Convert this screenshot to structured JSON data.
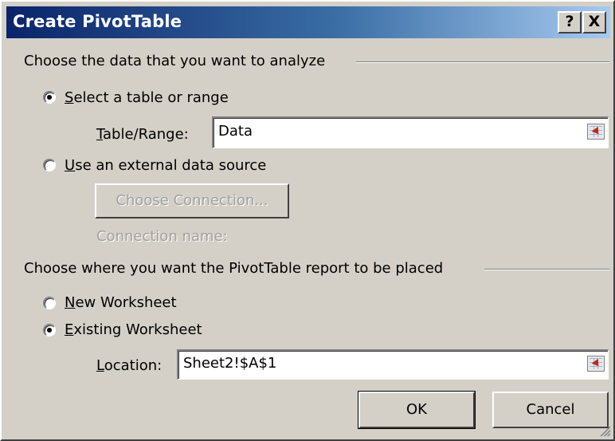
{
  "window": {
    "title": "Create PivotTable",
    "help_label": "?",
    "close_label": "X"
  },
  "analyze_group": {
    "heading": "Choose the data that you want to analyze",
    "option_table": {
      "mnemonic": "S",
      "rest": "elect a table or range",
      "selected": true
    },
    "table_range": {
      "label_mnemonic": "T",
      "label_rest": "able/Range:",
      "value": "Data"
    },
    "option_external": {
      "mnemonic": "U",
      "rest": "se an external data source",
      "selected": false
    },
    "choose_connection_label": "Choose Connection...",
    "connection_name_label": "Connection name:"
  },
  "placement_group": {
    "heading": "Choose where you want the PivotTable report to be placed",
    "option_new": {
      "mnemonic": "N",
      "rest": "ew Worksheet",
      "selected": false
    },
    "option_existing": {
      "mnemonic": "E",
      "rest": "xisting Worksheet",
      "selected": true
    },
    "location": {
      "label_mnemonic": "L",
      "label_rest": "ocation:",
      "value": "Sheet2!$A$1"
    }
  },
  "buttons": {
    "ok_label": "OK",
    "cancel_label": "Cancel"
  },
  "colors": {
    "title_gradient_start": "#0a246a",
    "title_gradient_end": "#a6caf0",
    "dialog_face": "#d4d0c8"
  }
}
